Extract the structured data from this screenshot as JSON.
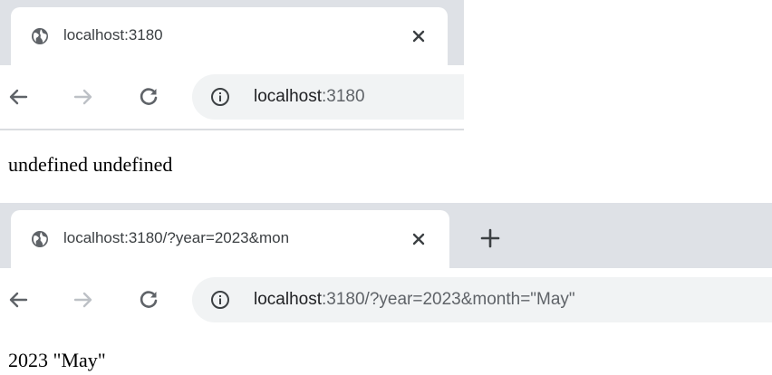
{
  "window1": {
    "tab": {
      "title": "localhost:3180",
      "favicon": "globe-icon",
      "close": "close-icon"
    },
    "toolbar": {
      "back": "arrow-left-icon",
      "forward": "arrow-right-icon",
      "reload": "reload-icon",
      "info": "info-icon",
      "url_host": "localhost",
      "url_path": ":3180"
    },
    "page_text": "undefined undefined"
  },
  "window2": {
    "tab": {
      "title": "localhost:3180/?year=2023&mon",
      "favicon": "globe-icon",
      "close": "close-icon"
    },
    "new_tab": "plus-icon",
    "toolbar": {
      "back": "arrow-left-icon",
      "forward": "arrow-right-icon",
      "reload": "reload-icon",
      "info": "info-icon",
      "url_host": "localhost",
      "url_path": ":3180/?year=2023&month=\"May\""
    },
    "page_text": "2023 \"May\""
  },
  "colors": {
    "tabstrip": "#dee1e6",
    "omnibox": "#f1f3f4",
    "text": "#202124",
    "muted": "#5f6368"
  }
}
